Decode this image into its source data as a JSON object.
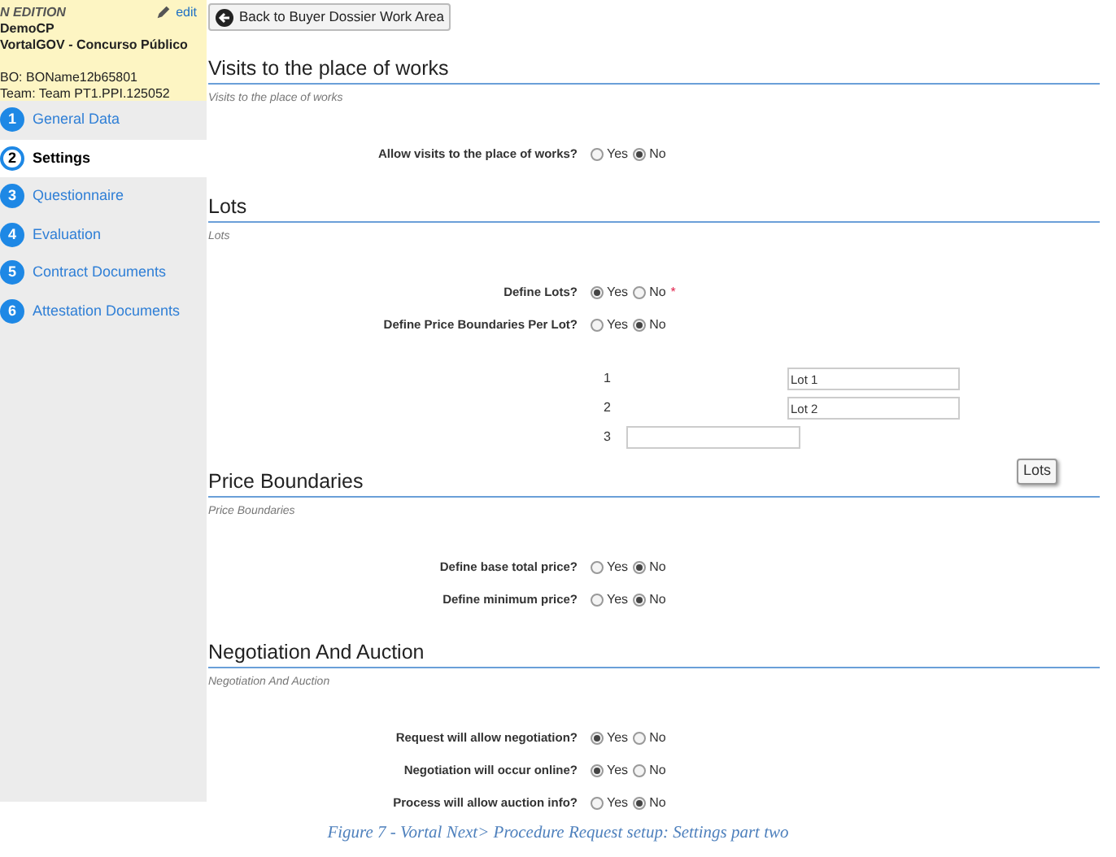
{
  "sidebar": {
    "status": "N EDITION",
    "edit_link": "edit",
    "name": "DemoCP",
    "procedure": "VortalGOV - Concurso Público",
    "bo": "BO: BOName12b65801",
    "team": "Team: Team PT1.PPI.125052",
    "steps": [
      {
        "number": "1",
        "label": "General Data",
        "selected": false
      },
      {
        "number": "2",
        "label": "Settings",
        "selected": true
      },
      {
        "number": "3",
        "label": "Questionnaire",
        "selected": false
      },
      {
        "number": "4",
        "label": "Evaluation",
        "selected": false
      },
      {
        "number": "5",
        "label": "Contract Documents",
        "selected": false
      },
      {
        "number": "6",
        "label": "Attestation Documents",
        "selected": false
      }
    ]
  },
  "back_button": "Back to Buyer Dossier Work Area",
  "sections": [
    {
      "title": "Visits to the place of works",
      "subtitle": "Visits to the place of works",
      "questions": [
        {
          "label": "Allow visits to the place of works?",
          "options": [
            {
              "label": "Yes",
              "selected": false
            },
            {
              "label": "No",
              "selected": true
            }
          ]
        }
      ]
    },
    {
      "title": "Lots",
      "subtitle": "Lots",
      "questions": [
        {
          "label": "Define Lots?",
          "required_mark": "*",
          "options": [
            {
              "label": "Yes",
              "selected": true
            },
            {
              "label": "No",
              "selected": false
            }
          ]
        },
        {
          "label": "Define Price Boundaries Per Lot?",
          "options": [
            {
              "label": "Yes",
              "selected": false
            },
            {
              "label": "No",
              "selected": true
            }
          ]
        }
      ],
      "lots": [
        {
          "number": "1",
          "value": "Lot 1"
        },
        {
          "number": "2",
          "value": "Lot 2"
        },
        {
          "number": "3"
        }
      ],
      "lots_button": "Lots"
    },
    {
      "title": "Price Boundaries",
      "subtitle": "Price Boundaries",
      "questions": [
        {
          "label": "Define base total price?",
          "options": [
            {
              "label": "Yes",
              "selected": false
            },
            {
              "label": "No",
              "selected": true
            }
          ]
        },
        {
          "label": "Define minimum price?",
          "options": [
            {
              "label": "Yes",
              "selected": false
            },
            {
              "label": "No",
              "selected": true
            }
          ]
        }
      ]
    },
    {
      "title": "Negotiation And Auction",
      "subtitle": "Negotiation And Auction",
      "questions": [
        {
          "label": "Request will allow negotiation?",
          "options": [
            {
              "label": "Yes",
              "selected": true
            },
            {
              "label": "No",
              "selected": false
            }
          ]
        },
        {
          "label": "Negotiation will occur online?",
          "options": [
            {
              "label": "Yes",
              "selected": true
            },
            {
              "label": "No",
              "selected": false
            }
          ]
        },
        {
          "label": "Process will allow auction info?",
          "options": [
            {
              "label": "Yes",
              "selected": false
            },
            {
              "label": "No",
              "selected": true
            }
          ]
        }
      ]
    }
  ],
  "caption": "Figure 7 - Vortal Next> Procedure Request setup: Settings part two"
}
